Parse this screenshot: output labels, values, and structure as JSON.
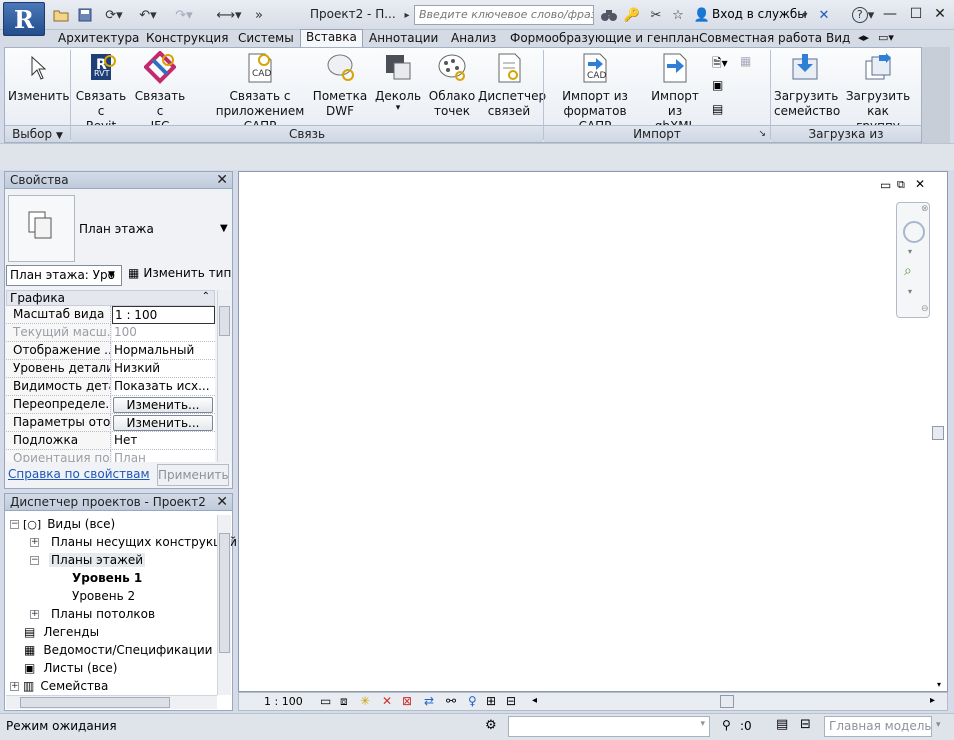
{
  "window": {
    "title": "Проект2 - П...",
    "search_placeholder": "Введите ключевое слово/фразу",
    "login_label": "Вход в службы",
    "app_letter": "R"
  },
  "tabs": [
    {
      "label": "Архитектура",
      "active": false
    },
    {
      "label": "Конструкция",
      "active": false
    },
    {
      "label": "Системы",
      "active": false
    },
    {
      "label": "Вставка",
      "active": true
    },
    {
      "label": "Аннотации",
      "active": false
    },
    {
      "label": "Анализ",
      "active": false
    },
    {
      "label": "Формообразующие и генплан",
      "active": false
    },
    {
      "label": "Совместная работа",
      "active": false
    },
    {
      "label": "Вид",
      "active": false
    }
  ],
  "ribbon": {
    "buttons": [
      {
        "line1": "Изменить",
        "line2": "",
        "icon": "cursor-icon"
      },
      {
        "line1": "Связать с",
        "line2": "Revit",
        "icon": "link-revit-icon"
      },
      {
        "line1": "Связать с",
        "line2": "IFC",
        "icon": "link-ifc-icon"
      },
      {
        "line1": "Связать с",
        "line2": "приложением САПР",
        "icon": "link-cad-icon"
      },
      {
        "line1": "Пометка",
        "line2": "DWF",
        "icon": "dwf-markup-icon"
      },
      {
        "line1": "Деколь",
        "line2": "▾",
        "icon": "decal-icon"
      },
      {
        "line1": "Облако",
        "line2": "точек",
        "icon": "point-cloud-icon"
      },
      {
        "line1": "Диспетчер",
        "line2": "связей",
        "icon": "manage-links-icon"
      },
      {
        "line1": "Импорт из",
        "line2": "форматов САПР",
        "icon": "import-cad-icon"
      },
      {
        "line1": "Импорт из",
        "line2": "gbXML",
        "icon": "import-gbxml-icon"
      },
      {
        "line1": "Загрузить",
        "line2": "семейство",
        "icon": "load-family-icon"
      },
      {
        "line1": "Загрузить как",
        "line2": "группу",
        "icon": "load-group-icon"
      }
    ],
    "panels": {
      "select": "Выбор",
      "link": "Связь",
      "import": "Импорт",
      "library": "Загрузка из библиотеки"
    }
  },
  "properties": {
    "title": "Свойства",
    "type_name": "План этажа",
    "type_selector": "План этажа: Уро",
    "edit_type": "Изменить тип",
    "group": "Графика",
    "rows": [
      {
        "key": "Масштаб вида",
        "value": "1 : 100",
        "kind": "input"
      },
      {
        "key": "Текущий масш...",
        "value": "100",
        "kind": "dim"
      },
      {
        "key": "Отображение ...",
        "value": "Нормальный",
        "kind": "text"
      },
      {
        "key": "Уровень детали...",
        "value": "Низкий",
        "kind": "text"
      },
      {
        "key": "Видимость дета...",
        "value": "Показать исх...",
        "kind": "text"
      },
      {
        "key": "Переопределе...",
        "value": "Изменить...",
        "kind": "button"
      },
      {
        "key": "Параметры ото...",
        "value": "Изменить...",
        "kind": "button"
      },
      {
        "key": "Подложка",
        "value": "Нет",
        "kind": "text"
      },
      {
        "key": "Ориентация по...",
        "value": "План",
        "kind": "dim"
      }
    ],
    "help_link": "Справка по свойствам",
    "apply": "Применить"
  },
  "browser": {
    "title": "Диспетчер проектов - Проект2",
    "nodes": [
      {
        "label": "Виды (все)",
        "indent": 0,
        "expander": "-",
        "icon": "views-icon",
        "bold": false,
        "selected": false
      },
      {
        "label": "Планы несущих конструкций",
        "indent": 1,
        "expander": "+",
        "icon": "",
        "bold": false,
        "selected": false
      },
      {
        "label": "Планы этажей",
        "indent": 1,
        "expander": "-",
        "icon": "",
        "bold": false,
        "selected": true
      },
      {
        "label": "Уровень 1",
        "indent": 2,
        "expander": "",
        "icon": "",
        "bold": true,
        "selected": false
      },
      {
        "label": "Уровень 2",
        "indent": 2,
        "expander": "",
        "icon": "",
        "bold": false,
        "selected": false
      },
      {
        "label": "Планы потолков",
        "indent": 1,
        "expander": "+",
        "icon": "",
        "bold": false,
        "selected": false
      },
      {
        "label": "Легенды",
        "indent": 0,
        "expander": "",
        "icon": "legend-icon",
        "bold": false,
        "selected": false
      },
      {
        "label": "Ведомости/Спецификации",
        "indent": 0,
        "expander": "",
        "icon": "schedule-icon",
        "bold": false,
        "selected": false
      },
      {
        "label": "Листы (все)",
        "indent": 0,
        "expander": "",
        "icon": "sheets-icon",
        "bold": false,
        "selected": false
      },
      {
        "label": "Семейства",
        "indent": 0,
        "expander": "+",
        "icon": "families-icon",
        "bold": false,
        "selected": false
      }
    ]
  },
  "view_bar": {
    "scale": "1 : 100"
  },
  "status": {
    "text": "Режим ожидания",
    "selection_count": ":0",
    "model": "Главная модель"
  }
}
